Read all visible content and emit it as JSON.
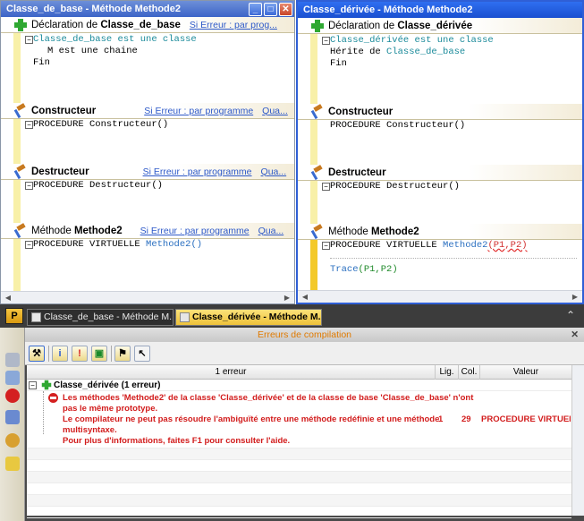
{
  "left_window": {
    "title": "Classe_de_base - Méthode Methode2",
    "sections": {
      "declaration": {
        "prefix": "Déclaration de ",
        "name": "Classe_de_base",
        "link1": "Si Erreur : par prog...",
        "code": [
          "Classe_de_base est une classe",
          "M est une chaine",
          "Fin"
        ]
      },
      "constructeur": {
        "name": "Constructeur",
        "link1": "Si Erreur : par programme",
        "link2": "Qua...",
        "code": "PROCEDURE Constructeur()"
      },
      "destructeur": {
        "name": "Destructeur",
        "link1": "Si Erreur : par programme",
        "link2": "Qua...",
        "code": "PROCEDURE Destructeur()"
      },
      "methode": {
        "prefix": "Méthode ",
        "name": "Methode2",
        "link1": "Si Erreur : par programme",
        "link2": "Qua...",
        "code_prefix": "PROCEDURE VIRTUELLE ",
        "code_name": "Methode2()"
      }
    }
  },
  "right_window": {
    "title": "Classe_dérivée - Méthode Methode2",
    "sections": {
      "declaration": {
        "prefix": "Déclaration de ",
        "name": "Classe_dérivée",
        "code": [
          "Classe_dérivée est une classe",
          "Hérite de ",
          "Classe_de_base",
          "Fin"
        ]
      },
      "constructeur": {
        "name": "Constructeur",
        "code": "PROCEDURE Constructeur()"
      },
      "destructeur": {
        "name": "Destructeur",
        "code": "PROCEDURE Destructeur()"
      },
      "methode": {
        "prefix": "Méthode ",
        "name": "Methode2",
        "code_prefix": "PROCEDURE VIRTUELLE ",
        "code_name": "Methode2",
        "code_params": "(P1,P2)",
        "trace_prefix": "Trace",
        "trace_params": "(P1,P2)"
      }
    }
  },
  "tabs": [
    {
      "label": "Classe_de_base - Méthode M..."
    },
    {
      "label": "Classe_dérivée - Méthode M..."
    }
  ],
  "panel": {
    "title": "Erreurs de compilation",
    "columns": {
      "errors": "1 erreur",
      "line": "Lig.",
      "col": "Col.",
      "value": "Valeur"
    },
    "group": "Classe_dérivée (1 erreur)",
    "error_lines": [
      "Les méthodes 'Methode2' de la classe 'Classe_dérivée' et de la classe de base 'Classe_de_base' n'ont",
      "pas le même prototype.",
      "Le compilateur ne peut pas résoudre l'ambiguïté entre une méthode redéfinie et une méthode",
      "multisyntaxe.",
      "Pour plus d'informations, faites F1 pour consulter l'aide."
    ],
    "line": "1",
    "col": "29",
    "value": "PROCEDURE VIRTUELLE I"
  },
  "colors": {
    "error": "#d21c1c",
    "accent": "#2d59c8",
    "tab_active": "#eec23a"
  }
}
